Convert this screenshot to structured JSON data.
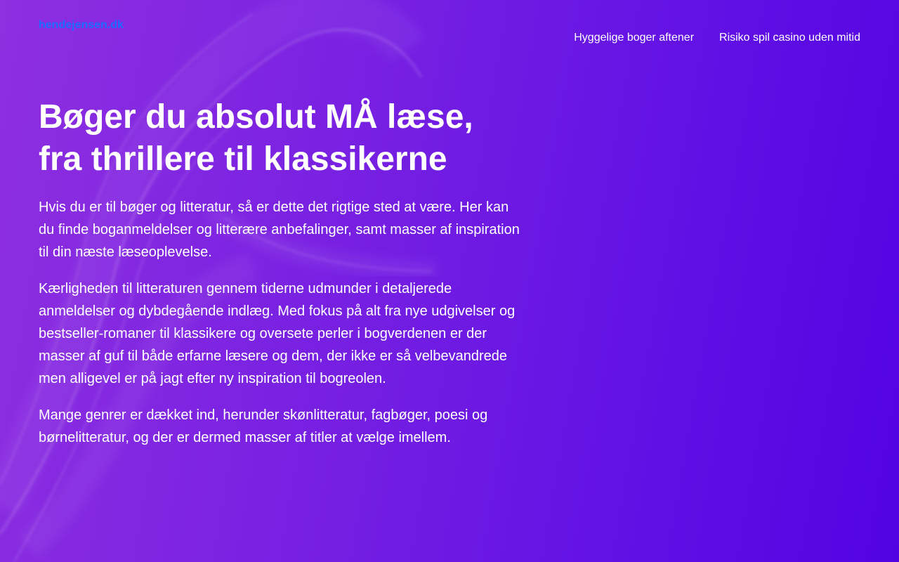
{
  "site": {
    "logo_text": "hendejensen.dk"
  },
  "nav": {
    "items": [
      {
        "label": "Hyggelige boger aftener"
      },
      {
        "label": "Risiko spil casino uden mitid"
      }
    ]
  },
  "hero": {
    "title_line1": "Bøger du absolut MÅ læse,",
    "title_line2": "fra thrillere til klassikerne",
    "paragraphs": [
      "Hvis du er til bøger og litteratur, så er dette det rigtige sted at være. Her kan du finde boganmeldelser og litterære anbefalinger, samt masser af inspiration til din næste læseoplevelse.",
      "Kærligheden til litteraturen gennem tiderne udmunder i detaljerede anmeldelser og dybdegående indlæg. Med fokus på alt fra nye udgivelser og bestseller-romaner til klassikere og oversete perler i bogverdenen er der masser af guf til både erfarne læsere og dem, der ikke er så velbevandrede men alligevel er på jagt efter ny inspiration til bogreolen.",
      "Mange genrer er dækket ind, herunder skønlitteratur, fagbøger, poesi og børnelitteratur, og der er dermed masser af titler at vælge imellem."
    ]
  },
  "colors": {
    "background_start": "#8e2fe0",
    "background_end": "#5203e2",
    "logo": "#1a6dff",
    "text": "#ffffff"
  }
}
